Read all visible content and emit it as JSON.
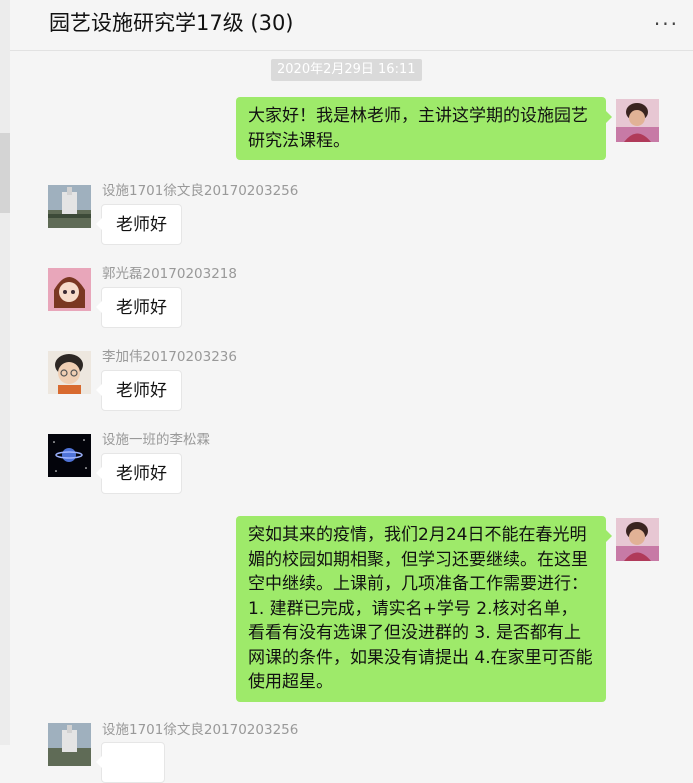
{
  "chat": {
    "title": "园艺设施研究学17级 (30)",
    "more_icon": "more-dots-icon"
  },
  "timestamp": "2020年2月29日 16:11",
  "messages": [
    {
      "sender": "林老师",
      "side": "right",
      "text": "大家好！我是林老师，主讲这学期的设施园艺研究法课程。"
    },
    {
      "sender": "设施1701徐文良20170203256",
      "side": "left",
      "text": "老师好"
    },
    {
      "sender": "郭光磊20170203218",
      "side": "left",
      "text": "老师好"
    },
    {
      "sender": "李加伟20170203236",
      "side": "left",
      "text": "老师好"
    },
    {
      "sender": "设施一班的李松霖",
      "side": "left",
      "text": "老师好"
    },
    {
      "sender": "林老师",
      "side": "right",
      "text": "突如其来的疫情，我们2月24日不能在春光明媚的校园如期相聚，但学习还要继续。在这里空中继续。上课前，几项准备工作需要进行：1. 建群已完成，请实名+学号 2.核对名单，看看有没有选课了但没进群的 3. 是否都有上网课的条件，如果没有请提出 4.在家里可否能使用超星。"
    },
    {
      "sender": "设施1701徐文良20170203256",
      "side": "left",
      "text": ""
    }
  ],
  "colors": {
    "self_bubble": "#9eea6a",
    "other_bubble": "#ffffff",
    "background": "#f5f5f5"
  }
}
